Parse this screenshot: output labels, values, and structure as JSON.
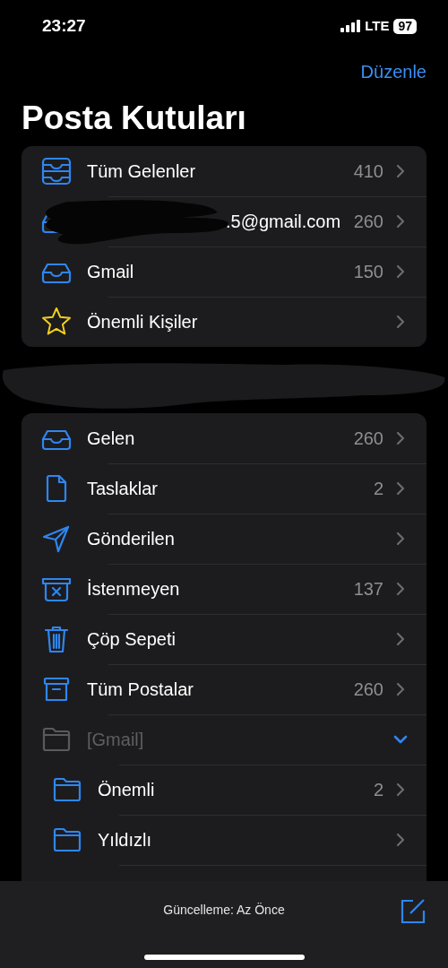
{
  "status_bar": {
    "time": "23:27",
    "network": "LTE",
    "battery": "97"
  },
  "nav": {
    "edit": "Düzenle",
    "title": "Posta Kutuları"
  },
  "groups": [
    {
      "items": [
        {
          "kind": "all-inboxes",
          "label": "Tüm Gelenler",
          "count": "410"
        },
        {
          "kind": "account",
          "label": ".5@gmail.com",
          "count": "260"
        },
        {
          "kind": "inbox",
          "label": "Gmail",
          "count": "150"
        },
        {
          "kind": "vip",
          "label": "Önemli Kişiler"
        }
      ]
    },
    {
      "items": [
        {
          "kind": "inbox",
          "label": "Gelen",
          "count": "260"
        },
        {
          "kind": "drafts",
          "label": "Taslaklar",
          "count": "2"
        },
        {
          "kind": "sent",
          "label": "Gönderilen"
        },
        {
          "kind": "junk",
          "label": "İstenmeyen",
          "count": "137"
        },
        {
          "kind": "trash",
          "label": "Çöp Sepeti"
        },
        {
          "kind": "archive",
          "label": "Tüm Postalar",
          "count": "260"
        },
        {
          "kind": "folder",
          "label": "[Gmail]",
          "disabled": true,
          "expanded": true,
          "children": [
            {
              "kind": "folder",
              "label": "Önemli",
              "count": "2"
            },
            {
              "kind": "folder",
              "label": "Yıldızlı"
            }
          ]
        }
      ]
    }
  ],
  "toolbar": {
    "status": "Güncelleme: Az Önce"
  }
}
